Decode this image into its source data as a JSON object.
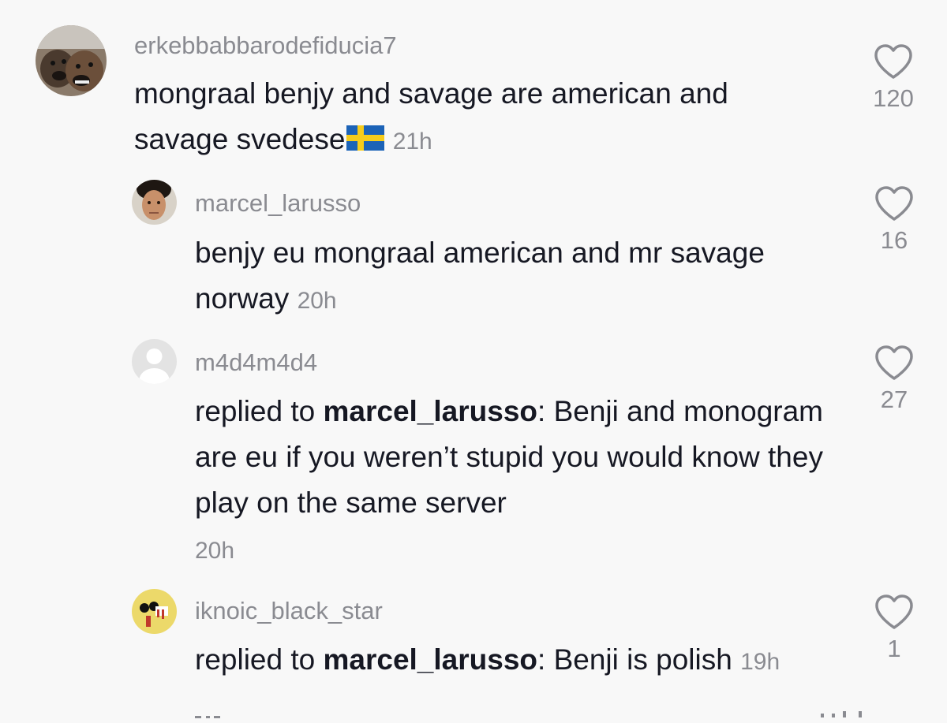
{
  "comments": [
    {
      "username": "erkebbabbarodefiducia7",
      "text": "mongraal benjy and savage are american and savage svedese",
      "flag": "swedish-flag",
      "time": "21h",
      "likes": "120"
    },
    {
      "username": "marcel_larusso",
      "text": "benjy eu mongraal american and mr savage norway",
      "time": "20h",
      "likes": "16"
    },
    {
      "username": "m4d4m4d4",
      "reply_prefix": "replied to ",
      "reply_to": "marcel_larusso",
      "text": ": Benji and monogram are eu if you weren’t stupid you would know they play on the same server",
      "time": "20h",
      "likes": "27"
    },
    {
      "username": "iknoic_black_star",
      "reply_prefix": "replied to ",
      "reply_to": "marcel_larusso",
      "text": ": Benji is polish",
      "time": "19h",
      "likes": "1"
    }
  ],
  "colors": {
    "background": "#f8f8f8",
    "text": "#161823",
    "secondary": "#8a8b91"
  }
}
